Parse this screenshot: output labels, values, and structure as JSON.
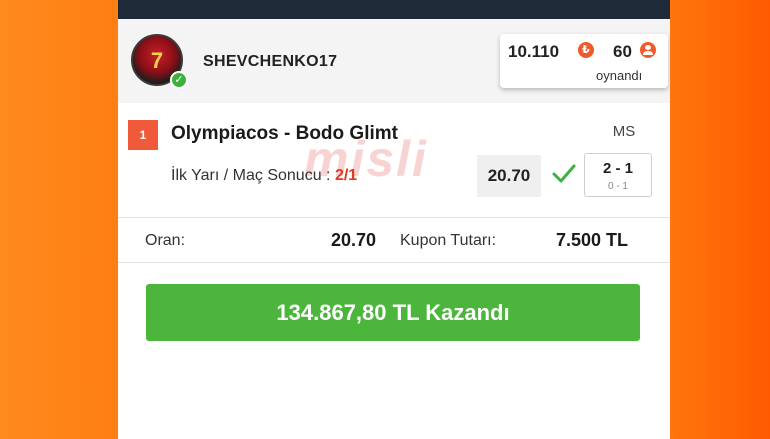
{
  "user": {
    "username": "SHEVCHENKO17",
    "avatar_number": "7",
    "verified": true
  },
  "stats": {
    "coins": "10.110",
    "coin_icon": "coin-icon",
    "played_count": "60",
    "played_label": "oynandı"
  },
  "match": {
    "index": "1",
    "title": "Olympiacos - Bodo Glimt",
    "market_label": "İlk Yarı / Maç Sonucu :",
    "pick": "2/1",
    "odd": "20.70",
    "result_type": "MS",
    "score_full": "2 - 1",
    "score_half": "0 - 1",
    "status": "won"
  },
  "watermark": "misli",
  "summary": {
    "oran_label": "Oran:",
    "oran_value": "20.70",
    "kupon_label": "Kupon Tutarı:",
    "kupon_value": "7.500 TL"
  },
  "win_button": {
    "label": "134.867,80 TL Kazandı"
  },
  "colors": {
    "background_orange": "#ff6a00",
    "accent_red": "#f05a3a",
    "win_green": "#4cb63c",
    "topbar": "#1f2a38"
  }
}
